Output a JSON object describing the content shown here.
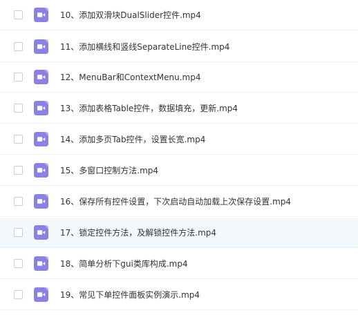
{
  "colors": {
    "icon_bg": "#8a80e8",
    "icon_fg": "#ffffff",
    "highlight_bg": "#f3f8fd",
    "text": "#333333"
  },
  "file_list": {
    "items": [
      {
        "name": "10、添加双滑块DualSlider控件.mp4",
        "icon": "video-file-icon",
        "checked": false,
        "highlighted": false
      },
      {
        "name": "11、添加横线和竖线SeparateLine控件.mp4",
        "icon": "video-file-icon",
        "checked": false,
        "highlighted": false
      },
      {
        "name": "12、MenuBar和ContextMenu.mp4",
        "icon": "video-file-icon",
        "checked": false,
        "highlighted": false
      },
      {
        "name": "13、添加表格Table控件，数据填充，更新.mp4",
        "icon": "video-file-icon",
        "checked": false,
        "highlighted": false
      },
      {
        "name": "14、添加多页Tab控件，设置长宽.mp4",
        "icon": "video-file-icon",
        "checked": false,
        "highlighted": false
      },
      {
        "name": "15、多窗口控制方法.mp4",
        "icon": "video-file-icon",
        "checked": false,
        "highlighted": false
      },
      {
        "name": "16、保存所有控件设置，下次启动自动加载上次保存设置.mp4",
        "icon": "video-file-icon",
        "checked": false,
        "highlighted": false
      },
      {
        "name": "17、锁定控件方法，及解锁控件方法.mp4",
        "icon": "video-file-icon",
        "checked": false,
        "highlighted": true
      },
      {
        "name": "18、简单分析下gui类库构成.mp4",
        "icon": "video-file-icon",
        "checked": false,
        "highlighted": false
      },
      {
        "name": "19、常见下单控件面板实例演示.mp4",
        "icon": "video-file-icon",
        "checked": false,
        "highlighted": false
      }
    ]
  }
}
